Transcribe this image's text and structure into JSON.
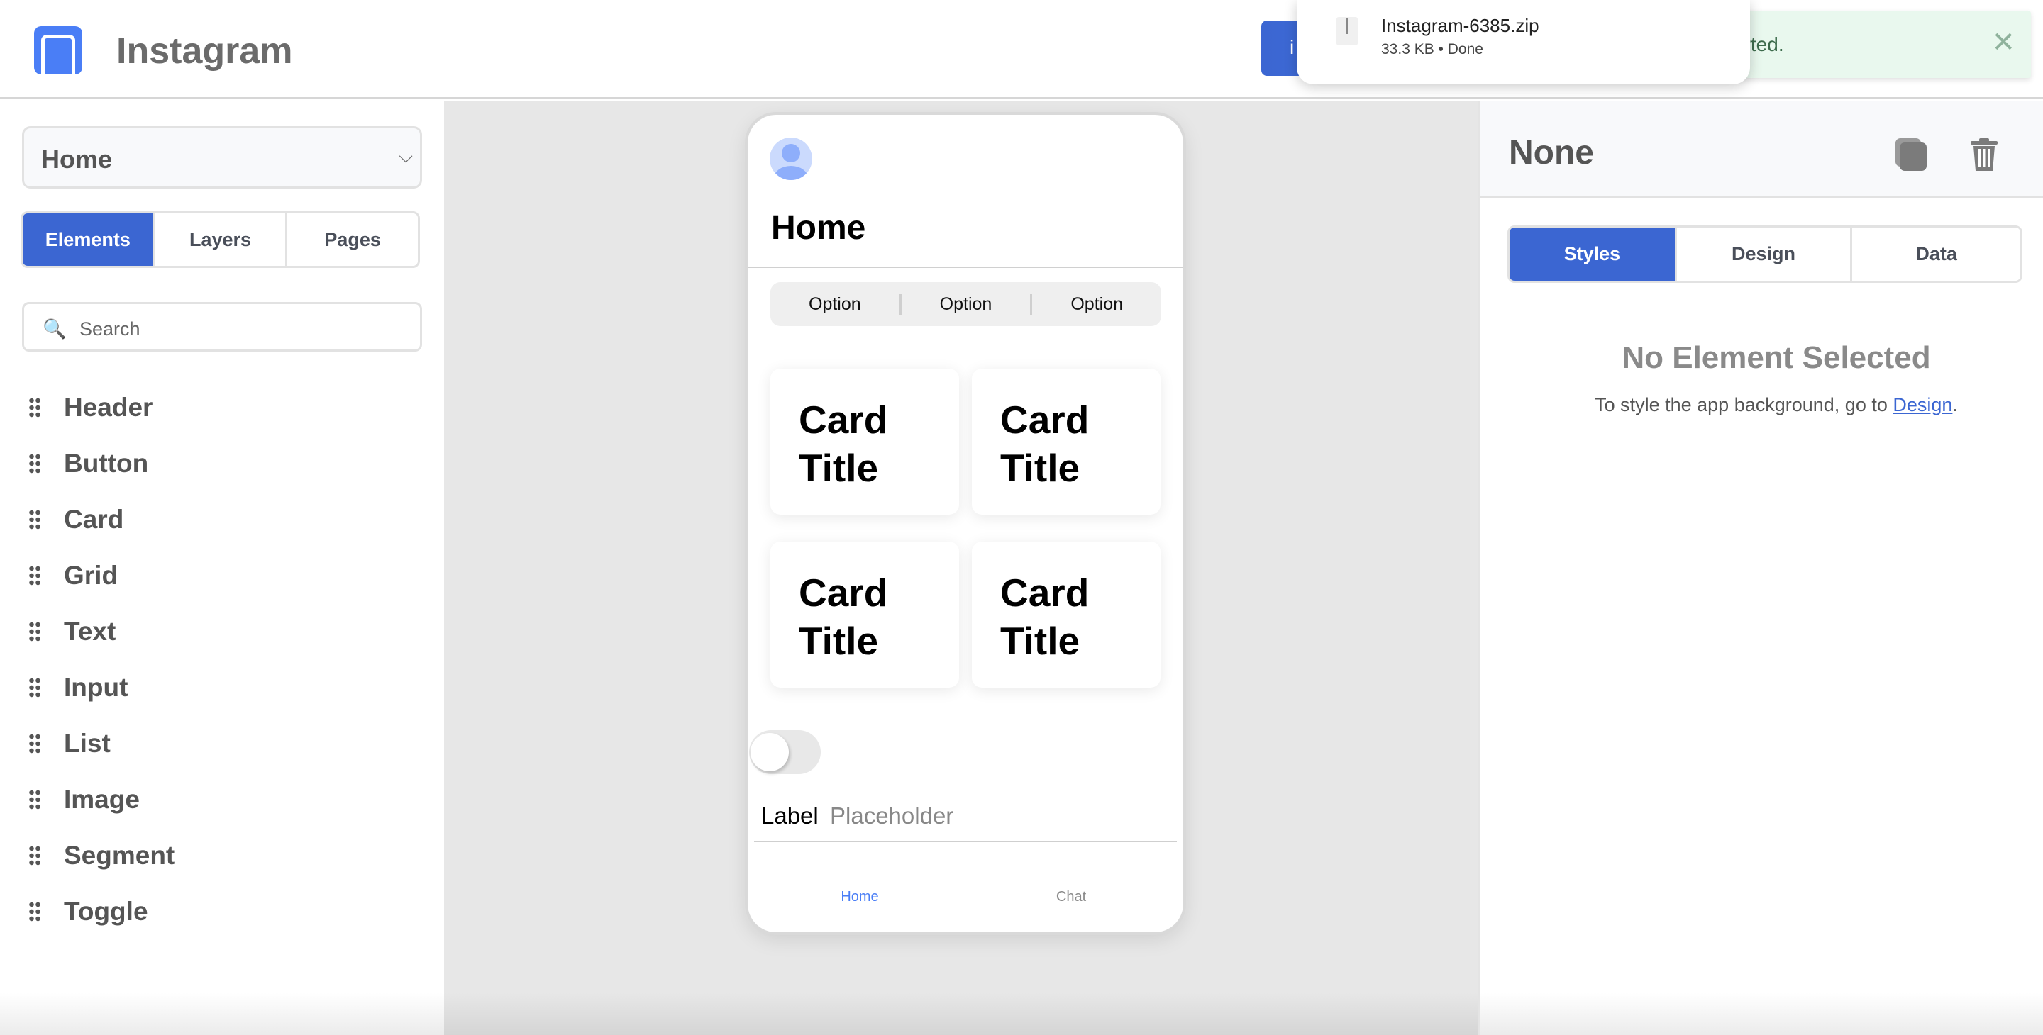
{
  "app": {
    "title": "Instagram",
    "logo_icon": "phone-icon",
    "accent": "#3b66d2"
  },
  "topbar": {
    "button_label": "i",
    "toast": {
      "text": "orted.",
      "close": "✕",
      "bg": "#e9f8ee"
    }
  },
  "download": {
    "filename": "Instagram-6385.zip",
    "meta": "33.3 KB • Done",
    "icon": "zip-file-icon"
  },
  "sidebar": {
    "page_select": "Home",
    "tabs": [
      {
        "label": "Elements",
        "active": true
      },
      {
        "label": "Layers"
      },
      {
        "label": "Pages"
      }
    ],
    "search_placeholder": "Search",
    "items": [
      "Header",
      "Button",
      "Card",
      "Grid",
      "Text",
      "Input",
      "List",
      "Image",
      "Segment",
      "Toggle"
    ]
  },
  "phone": {
    "title": "Home",
    "segment": [
      "Option",
      "Option",
      "Option"
    ],
    "cards": [
      "Card Title",
      "Card Title",
      "Card Title",
      "Card Title"
    ],
    "toggle_on": false,
    "input": {
      "label": "Label",
      "placeholder": "Placeholder"
    },
    "nav": [
      {
        "label": "Home",
        "active": true
      },
      {
        "label": "Chat"
      }
    ]
  },
  "inspector": {
    "title": "None",
    "tabs": [
      {
        "label": "Styles",
        "active": true
      },
      {
        "label": "Design"
      },
      {
        "label": "Data"
      }
    ],
    "empty_title": "No Element Selected",
    "empty_text": "To style the app background, go to ",
    "empty_link": "Design",
    "empty_end": "."
  }
}
